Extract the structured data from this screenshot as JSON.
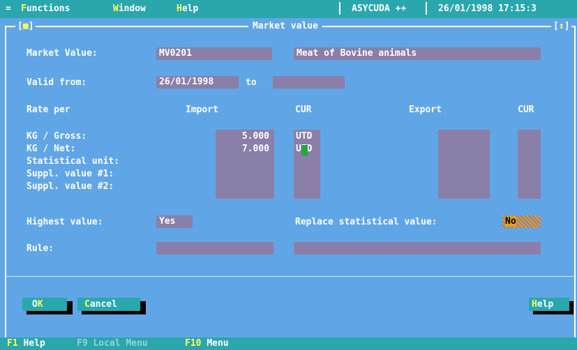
{
  "menubar": {
    "system_menu": "=",
    "items": [
      {
        "hot": "F",
        "rest": "unctions"
      },
      {
        "hot": "W",
        "rest": "indow"
      },
      {
        "hot": "H",
        "rest": "elp"
      }
    ],
    "app_name": "ASYCUDA ++",
    "datetime": "26/01/1998 17:15:3"
  },
  "window": {
    "title": "Market value",
    "close_box": "[■]",
    "resize_box": "[↕]"
  },
  "form": {
    "market_value_label": "Market Value:",
    "market_value_code": "MV0201",
    "market_value_description": "Meat of Bovine animals",
    "valid_from_label": "Valid from:",
    "valid_from_value": "26/01/1998",
    "to_label": "to",
    "valid_to_value": "",
    "rate_per_label": "Rate per",
    "import_header": "Import",
    "cur_header_import": "CUR",
    "export_header": "Export",
    "cur_header_export": "CUR",
    "rate_rows": [
      {
        "label": "KG / Gross:",
        "import": "5.000",
        "cur": "UTD"
      },
      {
        "label": "KG / Net:",
        "import": "7.000",
        "cur": "UTD"
      },
      {
        "label": "Statistical unit:",
        "import": "",
        "cur": ""
      },
      {
        "label": "Suppl. value #1:",
        "import": "",
        "cur": ""
      },
      {
        "label": "Suppl. value #2:",
        "import": "",
        "cur": ""
      }
    ],
    "highest_value_label": "Highest value:",
    "highest_value": "Yes",
    "replace_statistical_label": "Replace statistical value:",
    "replace_statistical_value": "No",
    "rule_label": "Rule:",
    "rule_value": "",
    "rule_value_2": ""
  },
  "buttons": {
    "ok": {
      "hot": "K",
      "prefix": "O",
      "label": "OK"
    },
    "cancel": {
      "hot": "C",
      "rest": "ancel"
    },
    "help": {
      "hot": "H",
      "rest": "elp"
    }
  },
  "statusbar": {
    "items": [
      {
        "key": "F1",
        "label": "Help",
        "enabled": true
      },
      {
        "key": "F9",
        "label": "Local Menu",
        "enabled": false
      },
      {
        "key": "F10",
        "label": "Menu",
        "enabled": true
      }
    ]
  },
  "colors": {
    "desktop": "#60a6e6",
    "bar": "#2aa6ad",
    "field": "#8a7fa8",
    "hotkey": "#ffff5a",
    "highlight": "#e0a020"
  }
}
